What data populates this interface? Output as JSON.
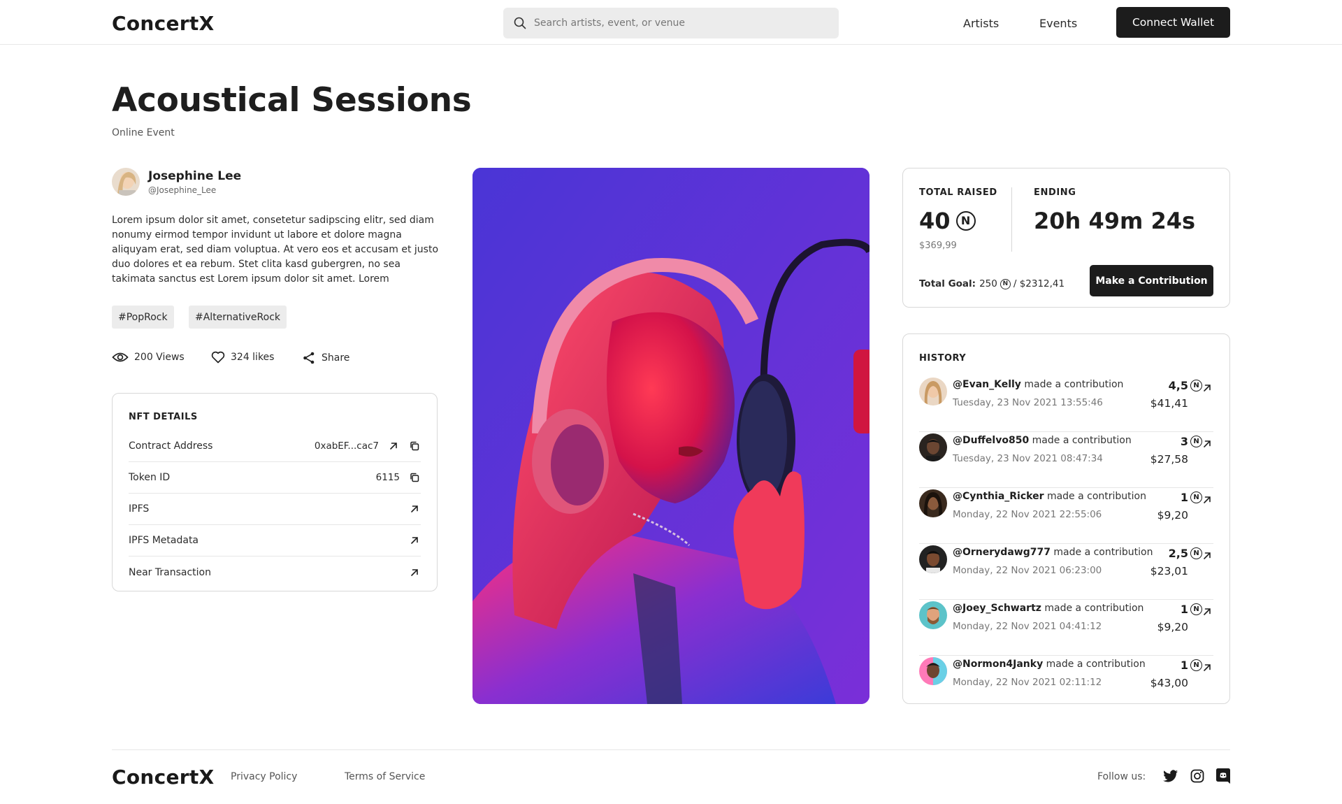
{
  "header": {
    "logo": "ConcertX",
    "search_placeholder": "Search artists, event, or venue",
    "nav": [
      "Artists",
      "Events"
    ],
    "connect_label": "Connect Wallet"
  },
  "event": {
    "title": "Acoustical Sessions",
    "subtitle": "Online Event"
  },
  "artist": {
    "name": "Josephine Lee",
    "handle": "@Josephine_Lee",
    "description": "Lorem ipsum dolor sit amet, consetetur sadipscing elitr, sed diam nonumy eirmod tempor invidunt ut labore et dolore magna aliquyam erat, sed diam voluptua. At vero eos et accusam et justo duo dolores et ea rebum. Stet clita kasd gubergren, no sea takimata sanctus est Lorem ipsum dolor sit amet. Lorem"
  },
  "tags": [
    "#PopRock",
    "#AlternativeRock"
  ],
  "stats": {
    "views": "200 Views",
    "likes": "324 likes",
    "share": "Share"
  },
  "nft": {
    "heading": "NFT DETAILS",
    "rows": [
      {
        "label": "Contract Address",
        "value": "0xabEF...cac7",
        "icons": [
          "external-link-icon",
          "copy-icon"
        ]
      },
      {
        "label": "Token ID",
        "value": "6115",
        "icons": [
          "copy-icon"
        ]
      },
      {
        "label": "IPFS",
        "value": "",
        "icons": [
          "external-link-icon"
        ]
      },
      {
        "label": "IPFS Metadata",
        "value": "",
        "icons": [
          "external-link-icon"
        ]
      },
      {
        "label": "Near Transaction",
        "value": "",
        "icons": [
          "external-link-icon"
        ]
      }
    ]
  },
  "funding": {
    "raised_label": "TOTAL RAISED",
    "raised_amount": "40",
    "raised_usd": "$369,99",
    "ending_label": "ENDING",
    "ending_time": "20h 49m 24s",
    "goal_label": "Total Goal:",
    "goal_amount": "250",
    "goal_usd": "/ $2312,41",
    "contribute_label": "Make a Contribution",
    "currency_symbol": "N"
  },
  "history": {
    "heading": "HISTORY",
    "action_text": "made a contribution",
    "items": [
      {
        "user": "@Evan_Kelly",
        "date": "Tuesday, 23 Nov 2021 13:55:46",
        "amount": "4,5",
        "usd": "$41,41"
      },
      {
        "user": "@Duffelvo850",
        "date": "Tuesday, 23 Nov 2021 08:47:34",
        "amount": "3",
        "usd": "$27,58"
      },
      {
        "user": "@Cynthia_Ricker",
        "date": "Monday, 22 Nov 2021 22:55:06",
        "amount": "1",
        "usd": "$9,20"
      },
      {
        "user": "@Ornerydawg777",
        "date": "Monday, 22 Nov 2021 06:23:00",
        "amount": "2,5",
        "usd": "$23,01"
      },
      {
        "user": "@Joey_Schwartz",
        "date": "Monday, 22 Nov 2021 04:41:12",
        "amount": "1",
        "usd": "$9,20"
      },
      {
        "user": "@Normon4Janky",
        "date": "Monday, 22 Nov 2021 02:11:12",
        "amount": "1",
        "usd": "$43,00"
      }
    ]
  },
  "footer": {
    "logo": "ConcertX",
    "links": [
      "Privacy Policy",
      "Terms of Service"
    ],
    "follow": "Follow us:",
    "socials": [
      "twitter-icon",
      "instagram-icon",
      "discord-icon"
    ]
  },
  "colors": {
    "accent_dark": "#1c1c1c",
    "hero_purple": "#5a2fd6",
    "hero_red": "#ff1f4b"
  }
}
